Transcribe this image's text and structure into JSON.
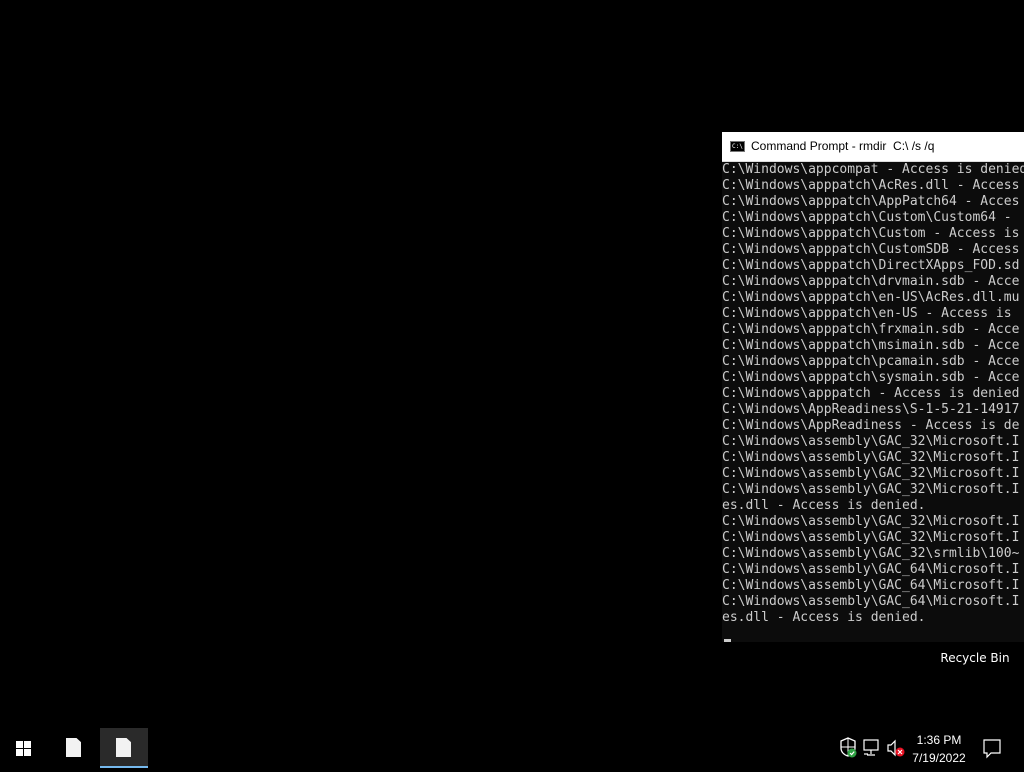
{
  "desktop": {
    "recycle_bin_label": "Recycle Bin"
  },
  "console": {
    "title": "Command Prompt - rmdir  C:\\ /s /q",
    "icon_text": "C:\\",
    "lines": [
      "C:\\Windows\\appcompat - Access is denied.",
      "C:\\Windows\\apppatch\\AcRes.dll - Access",
      "C:\\Windows\\apppatch\\AppPatch64 - Acces",
      "C:\\Windows\\apppatch\\Custom\\Custom64 - ",
      "C:\\Windows\\apppatch\\Custom - Access is",
      "C:\\Windows\\apppatch\\CustomSDB - Access",
      "C:\\Windows\\apppatch\\DirectXApps_FOD.sd",
      "C:\\Windows\\apppatch\\drvmain.sdb - Acce",
      "C:\\Windows\\apppatch\\en-US\\AcRes.dll.mu",
      "C:\\Windows\\apppatch\\en-US - Access is ",
      "C:\\Windows\\apppatch\\frxmain.sdb - Acce",
      "C:\\Windows\\apppatch\\msimain.sdb - Acce",
      "C:\\Windows\\apppatch\\pcamain.sdb - Acce",
      "C:\\Windows\\apppatch\\sysmain.sdb - Acce",
      "C:\\Windows\\apppatch - Access is denied",
      "C:\\Windows\\AppReadiness\\S-1-5-21-14917",
      "C:\\Windows\\AppReadiness - Access is de",
      "C:\\Windows\\assembly\\GAC_32\\Microsoft.I",
      "C:\\Windows\\assembly\\GAC_32\\Microsoft.I",
      "C:\\Windows\\assembly\\GAC_32\\Microsoft.I",
      "C:\\Windows\\assembly\\GAC_32\\Microsoft.I",
      "es.dll - Access is denied.",
      "C:\\Windows\\assembly\\GAC_32\\Microsoft.I",
      "C:\\Windows\\assembly\\GAC_32\\Microsoft.I",
      "C:\\Windows\\assembly\\GAC_32\\srmlib\\100~",
      "C:\\Windows\\assembly\\GAC_64\\Microsoft.I",
      "C:\\Windows\\assembly\\GAC_64\\Microsoft.I",
      "C:\\Windows\\assembly\\GAC_64\\Microsoft.I",
      "es.dll - Access is denied."
    ]
  },
  "taskbar": {
    "start_icon": "windows-logo-icon",
    "apps": [
      {
        "icon": "document-icon",
        "active": false
      },
      {
        "icon": "document-icon",
        "active": true
      }
    ],
    "tray": {
      "security_icon": "shield-check-icon",
      "network_icon": "network-icon",
      "volume_icon": "volume-muted-icon",
      "notifications_icon": "notifications-icon"
    },
    "clock": {
      "time": "1:36 PM",
      "date": "7/19/2022"
    }
  },
  "colors": {
    "desktop_bg": "#000000",
    "console_bg": "#0c0c0c",
    "console_text": "#cccccc",
    "taskbar_bg": "#000000",
    "active_indicator": "#76b9ed",
    "shield_green": "#2ea043",
    "mute_red": "#e81123"
  }
}
